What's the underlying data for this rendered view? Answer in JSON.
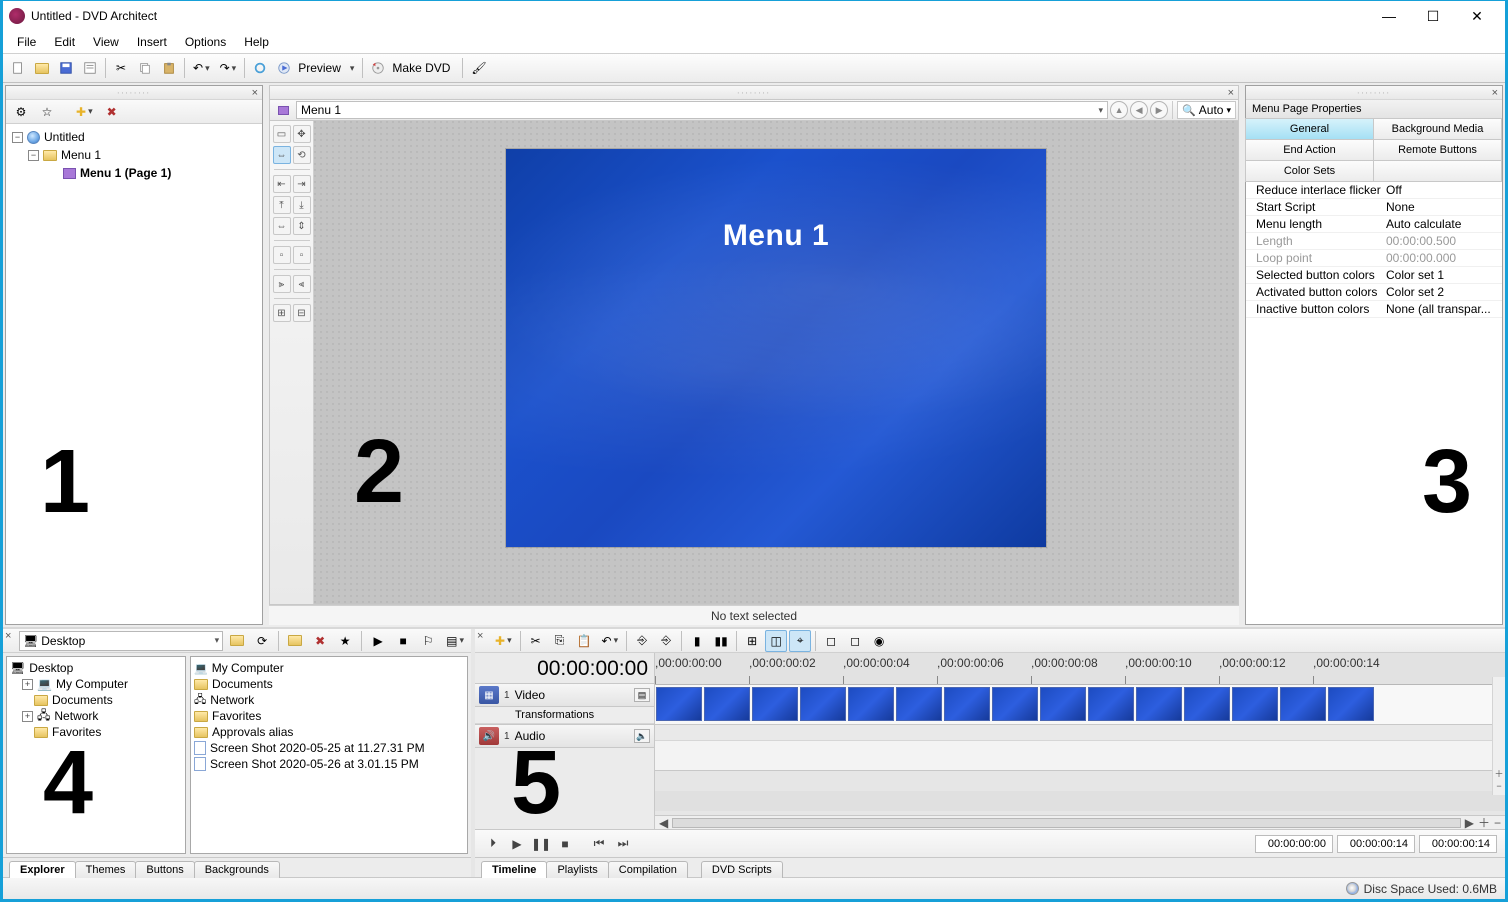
{
  "window": {
    "title": "Untitled - DVD Architect"
  },
  "menubar": [
    "File",
    "Edit",
    "View",
    "Insert",
    "Options",
    "Help"
  ],
  "toolbar": {
    "preview_label": "Preview",
    "make_dvd_label": "Make DVD"
  },
  "project_tree": {
    "root": "Untitled",
    "menu": "Menu 1",
    "page": "Menu 1 (Page 1)"
  },
  "preview": {
    "crumb": "Menu 1",
    "zoom_label": "Auto",
    "slide_title": "Menu 1",
    "status": "No text selected"
  },
  "properties": {
    "panel_title": "Menu Page Properties",
    "tabs": {
      "general": "General",
      "background": "Background Media",
      "end_action": "End Action",
      "remote": "Remote Buttons",
      "colorsets": "Color Sets"
    },
    "rows": [
      {
        "k": "Reduce interlace flicker",
        "v": "Off"
      },
      {
        "k": "Start Script",
        "v": "None"
      },
      {
        "k": "Menu length",
        "v": "Auto calculate"
      },
      {
        "k": "Length",
        "v": "00:00:00.500",
        "dim": true
      },
      {
        "k": "Loop point",
        "v": "00:00:00.000",
        "dim": true
      },
      {
        "k": "Selected button colors",
        "v": "Color set 1"
      },
      {
        "k": "Activated button colors",
        "v": "Color set 2"
      },
      {
        "k": "Inactive button colors",
        "v": "None (all transpar..."
      }
    ]
  },
  "explorer": {
    "path": "Desktop",
    "tree": [
      "Desktop",
      "My Computer",
      "Documents",
      "Network",
      "Favorites"
    ],
    "list": [
      {
        "icon": "computer",
        "name": "My Computer"
      },
      {
        "icon": "folder",
        "name": "Documents"
      },
      {
        "icon": "network",
        "name": "Network"
      },
      {
        "icon": "folder",
        "name": "Favorites"
      },
      {
        "icon": "folder",
        "name": "Approvals alias"
      },
      {
        "icon": "file",
        "name": "Screen Shot 2020-05-25 at 11.27.31 PM"
      },
      {
        "icon": "file",
        "name": "Screen Shot 2020-05-26 at 3.01.15 PM"
      }
    ],
    "tabs": [
      "Explorer",
      "Themes",
      "Buttons",
      "Backgrounds"
    ]
  },
  "timeline": {
    "current_time": "00:00:00:00",
    "ruler": [
      ",00:00:00:00",
      ",00:00:00:02",
      ",00:00:00:04",
      ",00:00:00:06",
      ",00:00:00:08",
      ",00:00:00:10",
      ",00:00:00:12",
      ",00:00:00:14"
    ],
    "track_video": "Video",
    "track_transform": "Transformations",
    "track_audio": "Audio",
    "timecodes": [
      "00:00:00:00",
      "00:00:00:14",
      "00:00:00:14"
    ],
    "tabs": [
      "Timeline",
      "Playlists",
      "Compilation",
      "DVD Scripts"
    ]
  },
  "statusbar": {
    "disc_label": "Disc Space Used: 0.6MB"
  },
  "overlays": {
    "n1": "1",
    "n2": "2",
    "n3": "3",
    "n4": "4",
    "n5": "5"
  }
}
